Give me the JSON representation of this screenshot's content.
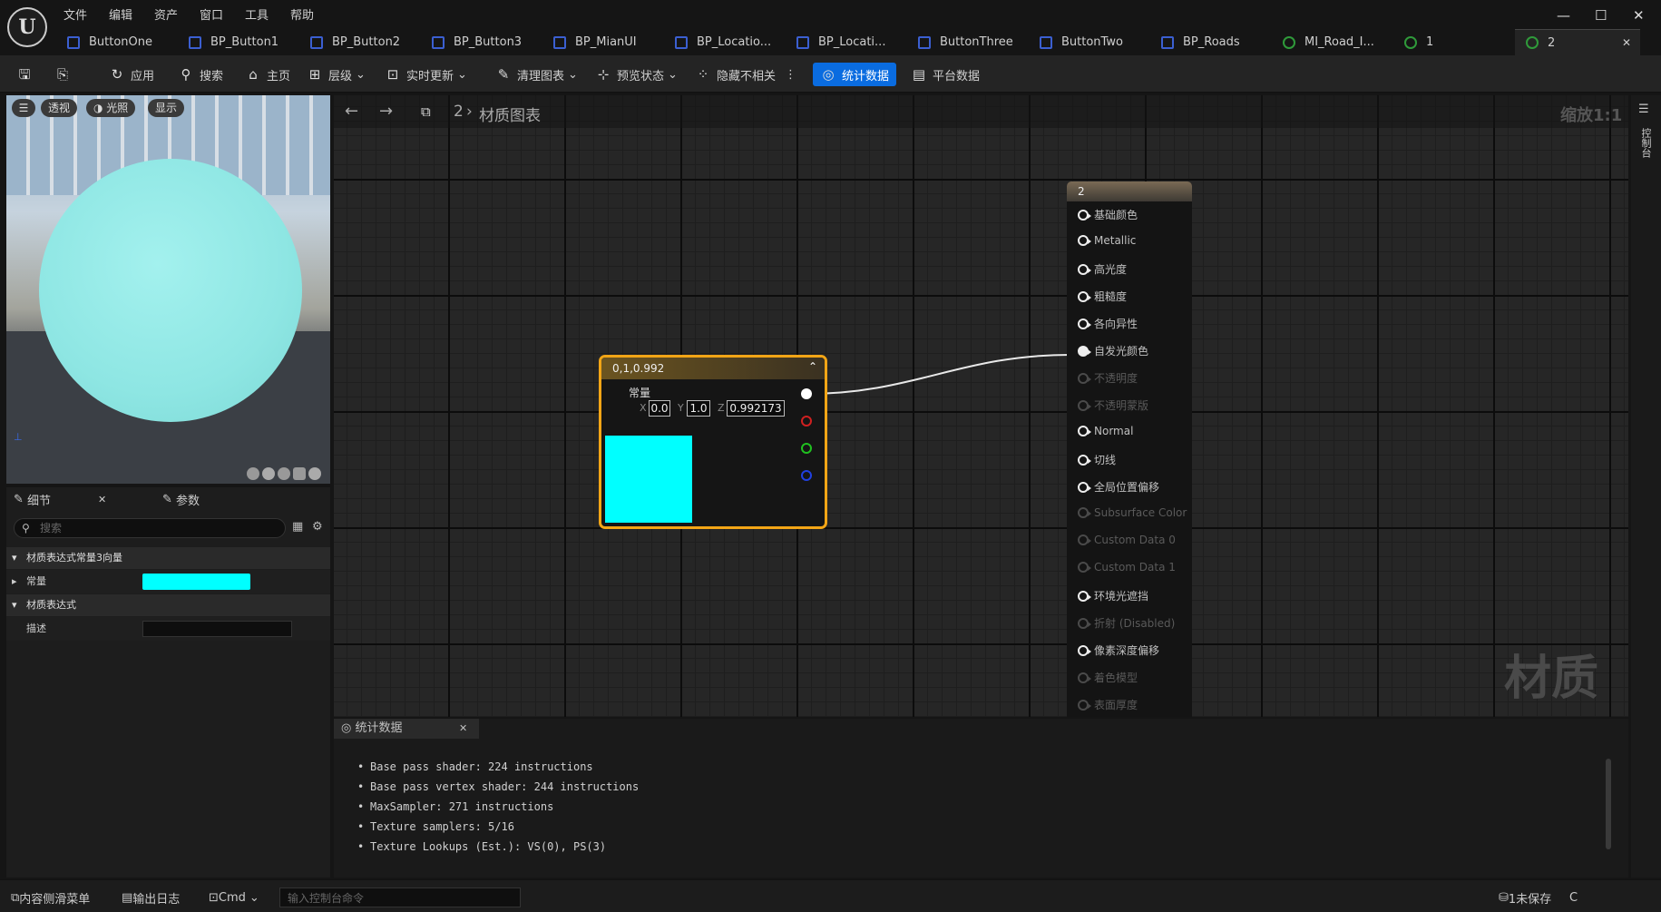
{
  "menu": [
    "文件",
    "编辑",
    "资产",
    "窗口",
    "工具",
    "帮助"
  ],
  "tabs": [
    {
      "label": "ButtonOne",
      "icon": "widget-blueprint-icon"
    },
    {
      "label": "BP_Button1",
      "icon": "blueprint-icon"
    },
    {
      "label": "BP_Button2",
      "icon": "blueprint-icon"
    },
    {
      "label": "BP_Button3",
      "icon": "blueprint-icon"
    },
    {
      "label": "BP_MianUI",
      "icon": "blueprint-icon"
    },
    {
      "label": "BP_Locatio...",
      "icon": "widget-blueprint-icon"
    },
    {
      "label": "BP_Locati...",
      "icon": "widget-blueprint-icon"
    },
    {
      "label": "ButtonThree",
      "icon": "widget-blueprint-icon"
    },
    {
      "label": "ButtonTwo",
      "icon": "widget-blueprint-icon"
    },
    {
      "label": "BP_Roads",
      "icon": "blueprint-icon"
    },
    {
      "label": "MI_Road_I...",
      "icon": "material-instance-icon"
    },
    {
      "label": "1",
      "icon": "material-icon"
    },
    {
      "label": "2",
      "icon": "material-icon",
      "active": true
    }
  ],
  "toolbar": {
    "apply": "应用",
    "search": "搜索",
    "home": "主页",
    "hierarchy": "层级",
    "live_update": "实时更新",
    "clean_graph": "清理图表",
    "preview_state": "预览状态",
    "hide_unrelated": "隐藏不相关",
    "stats": "统计数据",
    "platform_stats": "平台数据"
  },
  "viewport": {
    "perspective": "透视",
    "lit": "光照",
    "show": "显示",
    "sphere_color": "#8ee6e3"
  },
  "details": {
    "tab_details": "细节",
    "tab_params": "参数",
    "search_placeholder": "搜索",
    "cat_vector3": "材质表达式常量3向量",
    "prop_constant": "常量",
    "constant_swatch": "#00ffff",
    "cat_expression": "材质表达式",
    "prop_desc": "描述"
  },
  "graph": {
    "breadcrumb_root": "2",
    "breadcrumb_title": "材质图表",
    "zoom": "缩放1:1",
    "watermark": "材质",
    "const_node": {
      "title": "0,1,0.992",
      "label": "常量",
      "x": "0.0",
      "y": "1.0",
      "z": "0.992173",
      "preview": "#00ffff"
    },
    "mat_node": {
      "title": "2",
      "pins": [
        {
          "label": "基础颜色",
          "enabled": true
        },
        {
          "label": "Metallic",
          "enabled": true
        },
        {
          "label": "高光度",
          "enabled": true
        },
        {
          "label": "粗糙度",
          "enabled": true
        },
        {
          "label": "各向异性",
          "enabled": true
        },
        {
          "label": "自发光颜色",
          "enabled": true,
          "connected": true
        },
        {
          "label": "不透明度",
          "enabled": false
        },
        {
          "label": "不透明蒙版",
          "enabled": false
        },
        {
          "label": "Normal",
          "enabled": true
        },
        {
          "label": "切线",
          "enabled": true
        },
        {
          "label": "全局位置偏移",
          "enabled": true
        },
        {
          "label": "Subsurface Color",
          "enabled": false
        },
        {
          "label": "Custom Data 0",
          "enabled": false
        },
        {
          "label": "Custom Data 1",
          "enabled": false
        },
        {
          "label": "环境光遮挡",
          "enabled": true
        },
        {
          "label": "折射 (Disabled)",
          "enabled": false
        },
        {
          "label": "像素深度偏移",
          "enabled": true
        },
        {
          "label": "着色模型",
          "enabled": false
        },
        {
          "label": "表面厚度",
          "enabled": false
        }
      ]
    }
  },
  "stats_panel": {
    "tab": "统计数据",
    "lines": [
      "Base pass shader: 224 instructions",
      "Base pass vertex shader: 244 instructions",
      "MaxSampler: 271 instructions",
      "Texture samplers: 5/16",
      "Texture Lookups (Est.): VS(0), PS(3)"
    ]
  },
  "right_strip": "控制台",
  "statusbar": {
    "content_drawer": "内容侧滑菜单",
    "output_log": "输出日志",
    "cmd": "Cmd",
    "console_placeholder": "输入控制台命令",
    "unsaved": "1未保存",
    "source_control": "C"
  }
}
